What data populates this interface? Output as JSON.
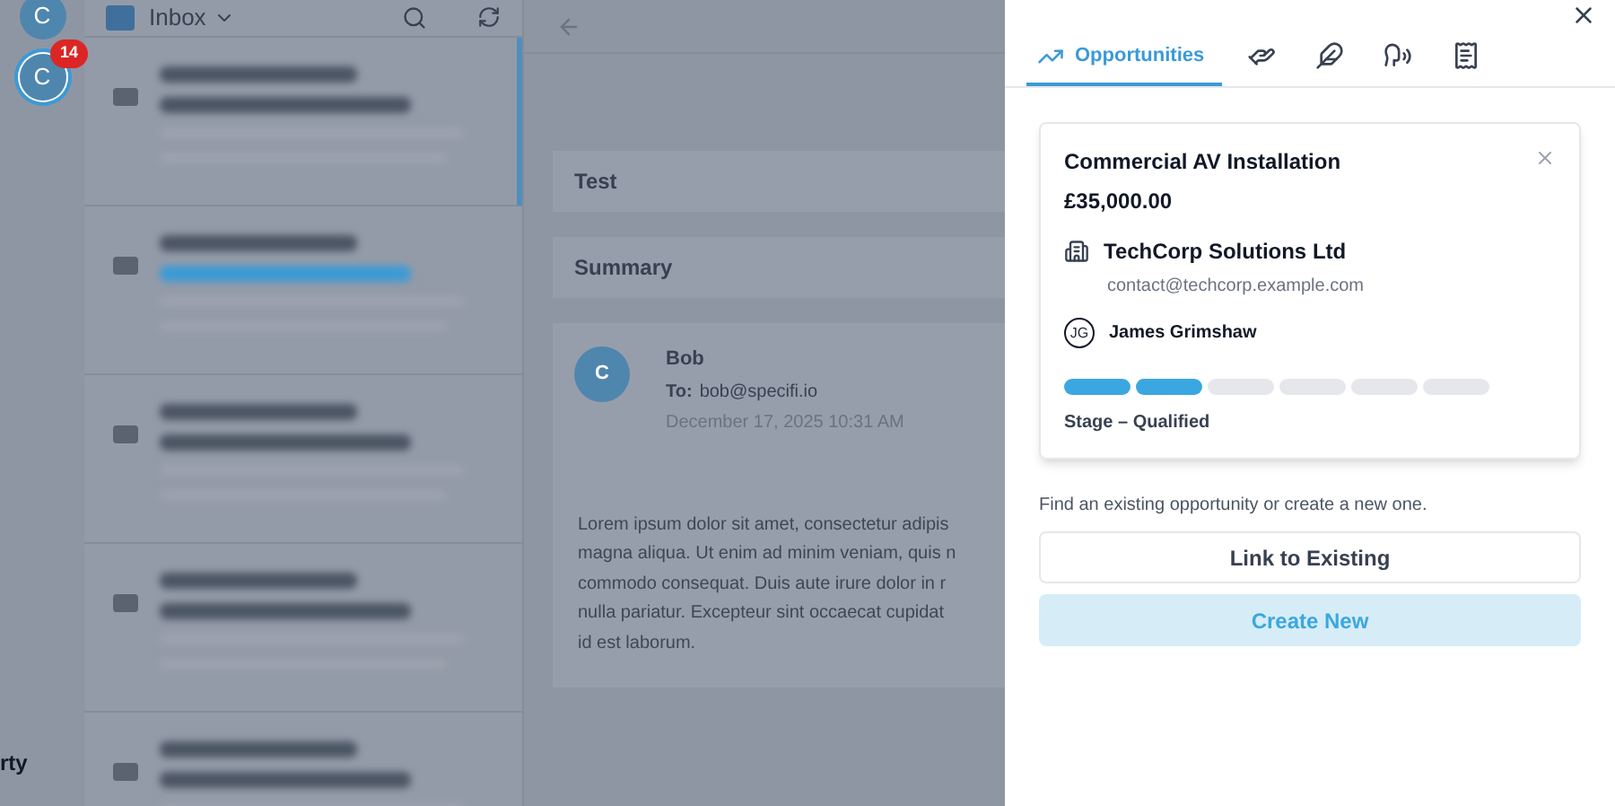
{
  "rail": {
    "accounts": [
      {
        "initial": "C",
        "selected": false
      },
      {
        "initial": "C",
        "badge": "14",
        "selected": true
      }
    ],
    "footer_text": "rty"
  },
  "mail_list": {
    "folder": "Inbox",
    "messages": [
      {
        "selected": true,
        "link_subject": false
      },
      {
        "selected": false,
        "link_subject": true
      },
      {
        "selected": false,
        "link_subject": false
      },
      {
        "selected": false,
        "link_subject": false
      },
      {
        "selected": false,
        "link_subject": false
      }
    ]
  },
  "reading_pane": {
    "subject": "Test",
    "summary_heading": "Summary",
    "message": {
      "avatar": "C",
      "sender": "Bob",
      "to_label": "To:",
      "to": "bob@specifi.io",
      "date": "December 17, 2025 10:31 AM",
      "body_lines": [
        "Lorem ipsum dolor sit amet, consectetur adipis",
        "magna aliqua. Ut enim ad minim veniam, quis n",
        "commodo consequat. Duis aute irure dolor in r",
        "nulla pariatur. Excepteur sint occaecat cupidat",
        "id est laborum."
      ]
    }
  },
  "panel": {
    "tabs": [
      {
        "kind": "labeled",
        "label": "Opportunities",
        "selected": true
      },
      {
        "kind": "icon",
        "selected": false
      },
      {
        "kind": "icon",
        "selected": false
      },
      {
        "kind": "icon",
        "selected": false
      },
      {
        "kind": "icon",
        "selected": false
      }
    ],
    "opportunity": {
      "title": "Commercial AV Installation",
      "amount": "£35,000.00",
      "company": "TechCorp Solutions Ltd",
      "email": "contact@techcorp.example.com",
      "contact_initials": "JG",
      "contact": "James Grimshaw",
      "stages": [
        {
          "done": true
        },
        {
          "done": true
        },
        {
          "done": false
        },
        {
          "done": false
        },
        {
          "done": false
        },
        {
          "done": false
        }
      ],
      "stage_label": "Stage – Qualified"
    },
    "hint": "Find an existing opportunity or create a new one.",
    "buttons": [
      {
        "kind": "secondary",
        "label": "Link to Existing"
      },
      {
        "kind": "primary",
        "label": "Create New"
      }
    ]
  }
}
